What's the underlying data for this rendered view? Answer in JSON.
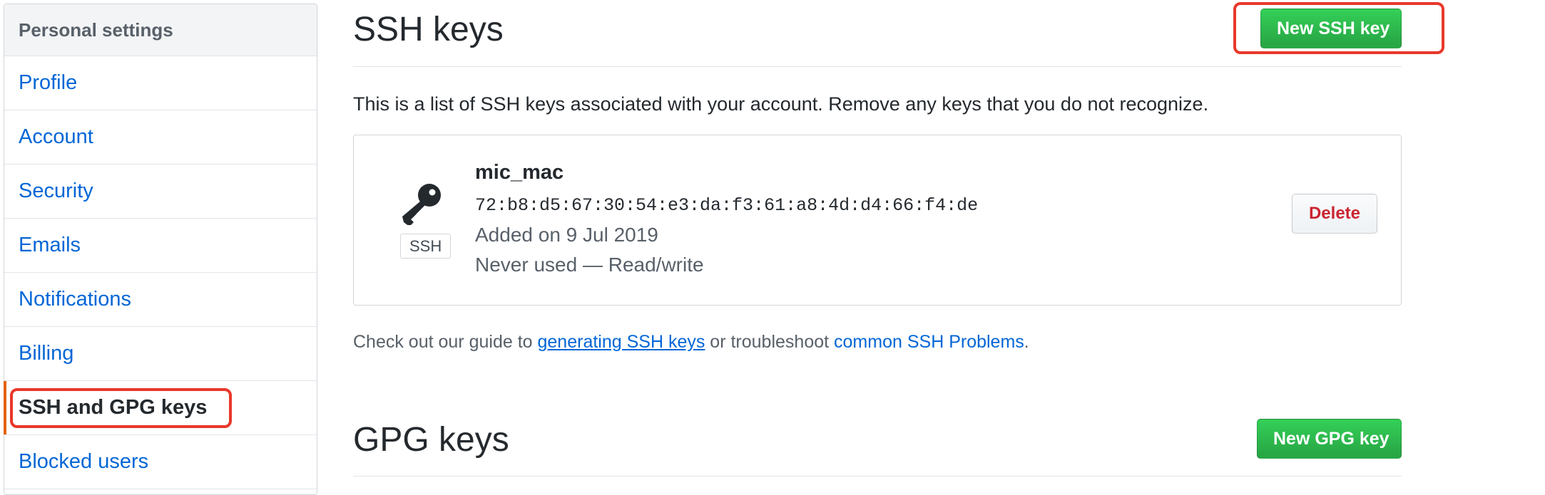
{
  "sidebar": {
    "header": "Personal settings",
    "items": [
      {
        "label": "Profile"
      },
      {
        "label": "Account"
      },
      {
        "label": "Security"
      },
      {
        "label": "Emails"
      },
      {
        "label": "Notifications"
      },
      {
        "label": "Billing"
      },
      {
        "label": "SSH and GPG keys",
        "selected": true
      },
      {
        "label": "Blocked users"
      }
    ]
  },
  "ssh": {
    "title": "SSH keys",
    "new_button": "New SSH key",
    "intro": "This is a list of SSH keys associated with your account. Remove any keys that you do not recognize.",
    "key": {
      "type_label": "SSH",
      "icon": "key-icon",
      "title": "mic_mac",
      "fingerprint": "72:b8:d5:67:30:54:e3:da:f3:61:a8:4d:d4:66:f4:de",
      "added": "Added on 9 Jul 2019",
      "usage": "Never used — Read/write",
      "delete_label": "Delete"
    },
    "guide": {
      "prefix": "Check out our guide to ",
      "link1": "generating SSH keys",
      "middle": " or troubleshoot ",
      "link2": "common SSH Problems",
      "suffix": "."
    }
  },
  "gpg": {
    "title": "GPG keys",
    "new_button": "New GPG key"
  },
  "colors": {
    "link": "#0366d6",
    "primary_button": "#28a745",
    "danger_text": "#cb2431",
    "selected_indicator": "#e36209",
    "annotation_box": "#e8382b"
  }
}
